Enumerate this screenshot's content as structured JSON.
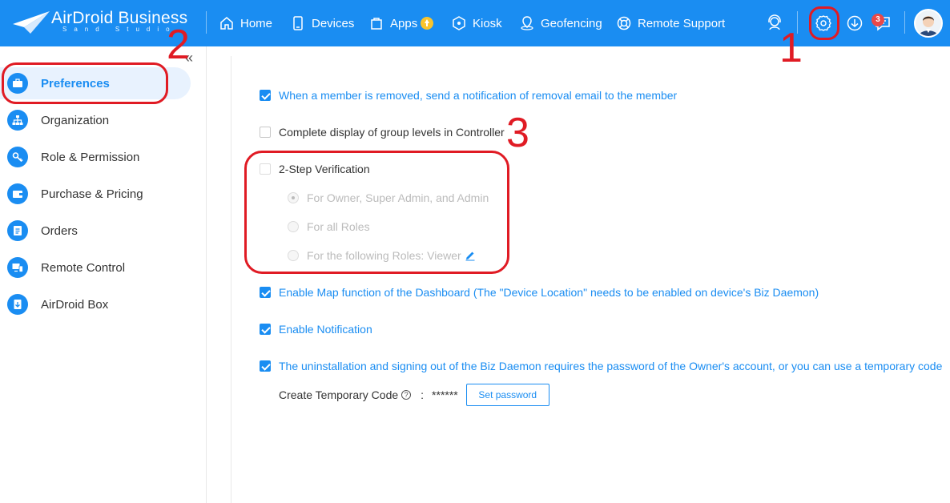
{
  "header": {
    "logo_title": "AirDroid Business",
    "logo_subtitle": "Sand Studio",
    "nav": [
      {
        "label": "Home",
        "icon": "home-icon"
      },
      {
        "label": "Devices",
        "icon": "device-icon"
      },
      {
        "label": "Apps",
        "icon": "apps-icon"
      },
      {
        "label": "Kiosk",
        "icon": "kiosk-icon"
      },
      {
        "label": "Geofencing",
        "icon": "geofence-icon"
      },
      {
        "label": "Remote Support",
        "icon": "remote-support-icon"
      }
    ],
    "message_count": "3",
    "brand_color": "#1a8df2"
  },
  "sidebar": {
    "collapse_label": "«",
    "items": [
      {
        "label": "Preferences",
        "icon": "briefcase-icon",
        "active": true
      },
      {
        "label": "Organization",
        "icon": "org-chart-icon"
      },
      {
        "label": "Role & Permission",
        "icon": "key-icon"
      },
      {
        "label": "Purchase & Pricing",
        "icon": "wallet-icon"
      },
      {
        "label": "Orders",
        "icon": "orders-icon"
      },
      {
        "label": "Remote Control",
        "icon": "remote-control-icon"
      },
      {
        "label": "AirDroid Box",
        "icon": "box-icon"
      }
    ]
  },
  "settings": {
    "removal_email": {
      "label": "When a member is removed, send a notification of removal email to the member",
      "checked": true
    },
    "group_levels": {
      "label": "Complete display of group levels in Controller",
      "checked": false
    },
    "two_step": {
      "label": "2-Step Verification",
      "checked": false,
      "options": [
        {
          "label": "For Owner, Super Admin, and Admin",
          "selected": true
        },
        {
          "label": "For all Roles",
          "selected": false
        },
        {
          "label": "For the following Roles: Viewer",
          "selected": false
        }
      ]
    },
    "map_function": {
      "label": "Enable Map function of the Dashboard (The \"Device Location\" needs to be enabled on device's Biz Daemon)",
      "checked": true
    },
    "notification": {
      "label": "Enable Notification",
      "checked": true
    },
    "uninstall_password": {
      "label": "The uninstallation and signing out of the Biz Daemon requires the password of the Owner's account, or you can use a temporary code",
      "checked": true
    },
    "temp_code": {
      "label": "Create Temporary Code",
      "help": "?",
      "colon": ":",
      "value": "******",
      "button": "Set password"
    }
  },
  "annotations": {
    "one": "1",
    "two": "2",
    "three": "3",
    "color": "#e01b24"
  }
}
